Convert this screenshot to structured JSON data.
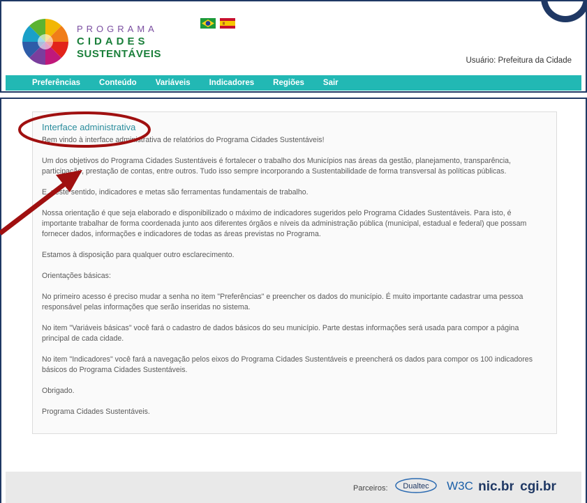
{
  "header": {
    "logo_line1": "PROGRAMA",
    "logo_line2": "CIDADES",
    "logo_line3": "SUSTENTÁVEIS",
    "user_label": "Usuário: Prefeitura da Cidade"
  },
  "nav": {
    "items": [
      "Preferências",
      "Conteúdo",
      "Variáveis",
      "Indicadores",
      "Regiões",
      "Sair"
    ]
  },
  "main": {
    "title": "Interface administrativa",
    "paragraphs": [
      "Bem vindo à interface administrativa de relatórios do Programa Cidades Sustentáveis!",
      "Um dos objetivos do Programa Cidades Sustentáveis é fortalecer o trabalho dos Municípios nas áreas da gestão, planejamento, transparência, participação, prestação de contas, entre outros. Tudo isso sempre incorporando a Sustentabilidade de forma transversal às políticas públicas.",
      "E, neste sentido, indicadores e metas são ferramentas fundamentais de trabalho.",
      "Nossa orientação é que seja elaborado e disponibilizado o máximo de indicadores sugeridos pelo Programa Cidades Sustentáveis. Para isto, é importante trabalhar de forma coordenada junto aos diferentes órgãos e níveis da administração pública (municipal, estadual e federal) que possam fornecer dados, informações e indicadores de todas as áreas previstas no Programa.",
      "Estamos à disposição para qualquer outro esclarecimento.",
      "Orientações básicas:",
      "No primeiro acesso é preciso mudar a senha no item \"Preferências\" e preencher os dados do município. É muito importante cadastrar uma pessoa responsável pelas informações que serão inseridas no sistema.",
      "No item \"Variáveis básicas\" você fará o cadastro de dados básicos do seu município. Parte destas informações será usada para compor a página principal de cada cidade.",
      "No item \"Indicadores\" você fará a navegação pelos eixos do Programa Cidades Sustentáveis e preencherá os dados para compor os 100 indicadores básicos do Programa Cidades Sustentáveis.",
      "Obrigado.",
      "Programa Cidades Sustentáveis."
    ]
  },
  "footer": {
    "partners_label": "Parceiros:",
    "partners": [
      "Dualtec",
      "W3C",
      "nic.br",
      "cgi.br"
    ]
  },
  "colors": {
    "nav_bg": "#22b8b4",
    "title": "#2a8c9c",
    "frame": "#1f3864",
    "annotation": "#a01010"
  }
}
